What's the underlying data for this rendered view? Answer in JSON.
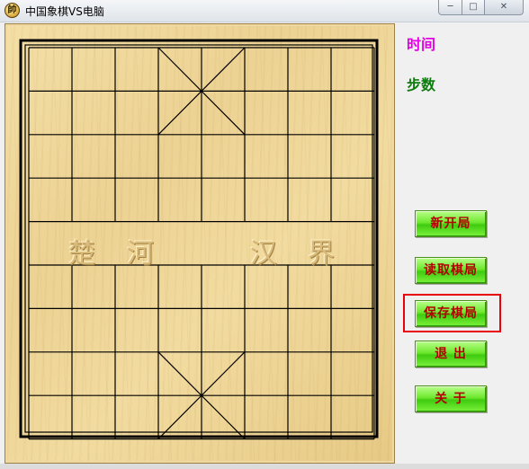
{
  "window": {
    "title": "中国象棋VS电脑",
    "icon": "xiangqi-piece-icon",
    "icon_glyph": "帥",
    "controls": {
      "minimize": "─",
      "maximize": "□",
      "close": "✕"
    }
  },
  "board": {
    "river_left": [
      "楚",
      "河"
    ],
    "river_right": [
      "汉",
      "界"
    ]
  },
  "info": {
    "time_label": "时间",
    "steps_label": "步数",
    "time_color": "#e400e4",
    "steps_color": "#0f7a0f"
  },
  "menu": {
    "new_game": "新开局",
    "load_game": "读取棋局",
    "save_game": "保存棋局",
    "exit": "退  出",
    "about": "关  于",
    "highlight_color": "#e8000a"
  }
}
